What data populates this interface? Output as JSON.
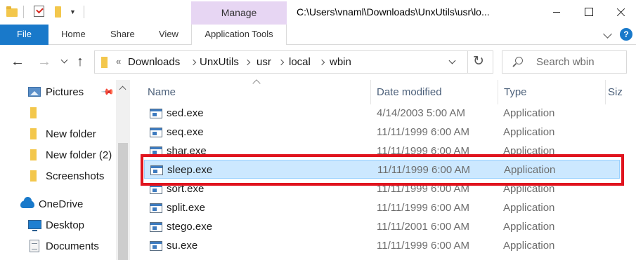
{
  "title_bar": {
    "manage_label": "Manage",
    "path": "C:\\Users\\vnaml\\Downloads\\UnxUtils\\usr\\lo..."
  },
  "ribbon": {
    "tabs": [
      "File",
      "Home",
      "Share",
      "View"
    ],
    "app_tools_label": "Application Tools",
    "accent_color": "#1979ca",
    "manage_color": "#e7d6f3"
  },
  "address_bar": {
    "breadcrumbs": [
      "Downloads",
      "UnxUtils",
      "usr",
      "local",
      "wbin"
    ],
    "overflow_glyph": "«"
  },
  "search": {
    "placeholder": "Search wbin"
  },
  "nav_pane": {
    "items": [
      {
        "label": "Pictures",
        "icon": "pictures-icon",
        "pinned": true
      },
      {
        "label": "",
        "icon": "folder-icon"
      },
      {
        "label": "New folder",
        "icon": "folder-icon"
      },
      {
        "label": "New folder (2)",
        "icon": "folder-icon"
      },
      {
        "label": "Screenshots",
        "icon": "folder-icon"
      },
      {
        "label": "OneDrive",
        "icon": "onedrive-icon"
      },
      {
        "label": "Desktop",
        "icon": "desktop-icon"
      },
      {
        "label": "Documents",
        "icon": "documents-icon"
      }
    ]
  },
  "file_list": {
    "columns": [
      "Name",
      "Date modified",
      "Type",
      "Siz"
    ],
    "rows": [
      {
        "name": "sed.exe",
        "date": "4/14/2003 5:00 AM",
        "type": "Application"
      },
      {
        "name": "seq.exe",
        "date": "11/11/1999 6:00 AM",
        "type": "Application"
      },
      {
        "name": "shar.exe",
        "date": "11/11/1999 6:00 AM",
        "type": "Application"
      },
      {
        "name": "sleep.exe",
        "date": "11/11/1999 6:00 AM",
        "type": "Application",
        "selected": true
      },
      {
        "name": "sort.exe",
        "date": "11/11/1999 6:00 AM",
        "type": "Application"
      },
      {
        "name": "split.exe",
        "date": "11/11/1999 6:00 AM",
        "type": "Application"
      },
      {
        "name": "stego.exe",
        "date": "11/11/2001 6:00 AM",
        "type": "Application"
      },
      {
        "name": "su.exe",
        "date": "11/11/1999 6:00 AM",
        "type": "Application"
      }
    ],
    "selection_color": "#cce8ff",
    "highlight_color": "#e0141e"
  }
}
